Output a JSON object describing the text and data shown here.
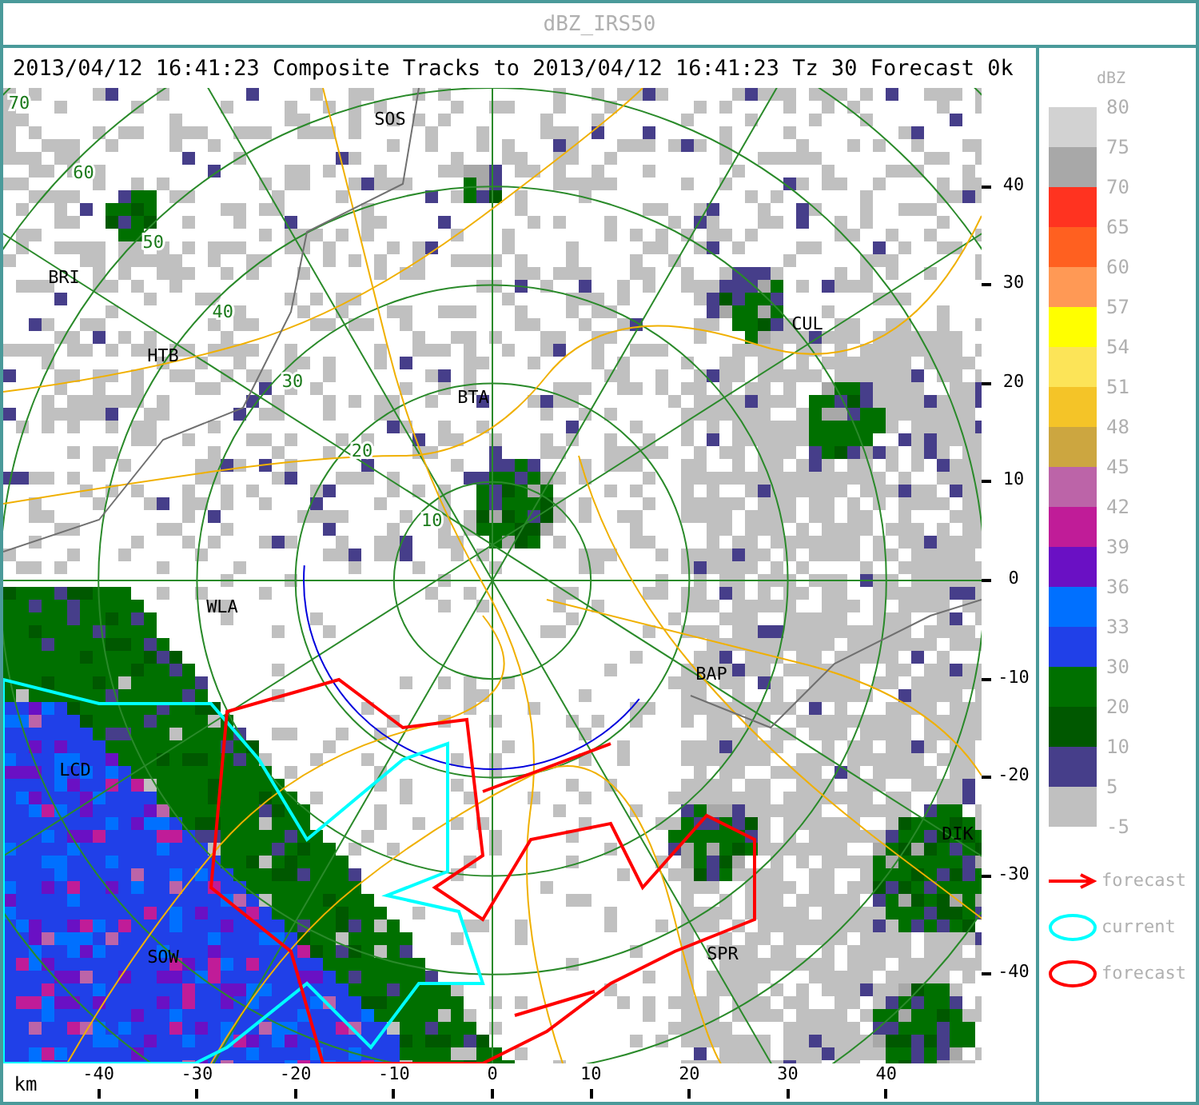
{
  "window": {
    "title": "dBZ_IRS50"
  },
  "header": "2013/04/12 16:41:23  Composite Tracks to 2013/04/12 16:41:23 Tz 30 Forecast 0k",
  "map": {
    "ring_labels": [
      "10",
      "20",
      "30",
      "40",
      "50",
      "60",
      "70"
    ],
    "places": [
      "SOS",
      "BRI",
      "HTB",
      "CUL",
      "BTA",
      "WLA",
      "BAP",
      "LCD",
      "SOW",
      "SPR",
      "DIK"
    ]
  },
  "y_axis": {
    "ticks": [
      "40",
      "30",
      "20",
      "10",
      "0",
      "-10",
      "-20",
      "-30",
      "-40"
    ]
  },
  "x_axis": {
    "unit": "km",
    "ticks": [
      "-40",
      "-30",
      "-20",
      "-10",
      "0",
      "10",
      "20",
      "30",
      "40"
    ]
  },
  "legend": {
    "title": "dBZ",
    "scale_labels": [
      "80",
      "75",
      "70",
      "65",
      "60",
      "57",
      "54",
      "51",
      "48",
      "45",
      "42",
      "39",
      "36",
      "33",
      "30",
      "20",
      "10",
      "5",
      "-5"
    ],
    "bands": [
      {
        "color": "#d2d2d2"
      },
      {
        "color": "#a8a8a8"
      },
      {
        "color": "#ff3320"
      },
      {
        "color": "#ff6020"
      },
      {
        "color": "#ff9955"
      },
      {
        "color": "#ffff00"
      },
      {
        "color": "#fce458"
      },
      {
        "color": "#f4c428"
      },
      {
        "color": "#cca640"
      },
      {
        "color": "#bc64a8"
      },
      {
        "color": "#c01c98"
      },
      {
        "color": "#6a10c4"
      },
      {
        "color": "#0070ff"
      },
      {
        "color": "#2040e8"
      },
      {
        "color": "#007000"
      },
      {
        "color": "#005800"
      },
      {
        "color": "#463e8a"
      },
      {
        "color": "#c0c0c0"
      }
    ],
    "symbols": [
      {
        "kind": "arrow",
        "label": "forecast",
        "color": "#ff0000"
      },
      {
        "kind": "outline",
        "label": "current",
        "color": "#00ffff"
      },
      {
        "kind": "outline",
        "label": "forecast",
        "color": "#ff0000"
      }
    ]
  }
}
